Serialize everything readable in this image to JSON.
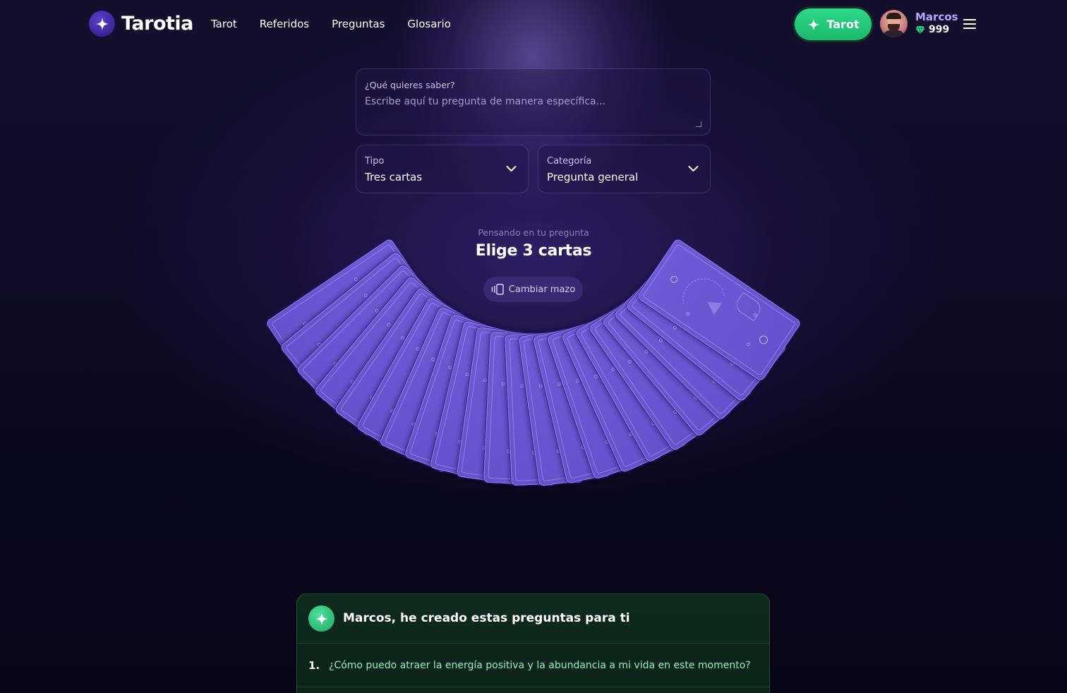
{
  "brand": {
    "name": "Tarotia"
  },
  "nav": {
    "links": [
      "Tarot",
      "Referidos",
      "Preguntas",
      "Glosario"
    ]
  },
  "header": {
    "cta_label": "Tarot",
    "user_name": "Marcos",
    "gems": "999"
  },
  "form": {
    "question_label": "¿Qué quieres saber?",
    "question_placeholder": "Escribe aquí tu pregunta de manera específica...",
    "type_label": "Tipo",
    "type_value": "Tres cartas",
    "category_label": "Categoría",
    "category_value": "Pregunta general"
  },
  "reading": {
    "thinking": "Pensando en tu pregunta",
    "instruction": "Elige 3 cartas",
    "change_deck": "Cambiar mazo",
    "card_count": 22
  },
  "suggestions": {
    "title": "Marcos, he creado estas preguntas para ti",
    "items": [
      {
        "number": "1.",
        "text": "¿Cómo puedo atraer la energía positiva y la abundancia a mi vida en este momento?"
      }
    ]
  },
  "colors": {
    "accent_green": "#1fc477",
    "card_purple": "#6f5ad6",
    "user_name": "#b7a6ff"
  },
  "icons": [
    "sparkle-icon",
    "chevron-down-icon",
    "gem-icon",
    "menu-icon",
    "deck-icon"
  ]
}
